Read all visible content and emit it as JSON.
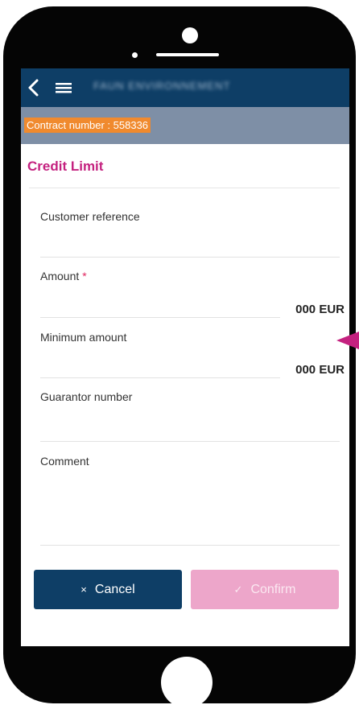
{
  "app": {
    "title": "FAUN ENVIRONNEMENT"
  },
  "contract": {
    "label": "Contract number : 558336"
  },
  "form": {
    "title": "Credit Limit",
    "customer_reference": {
      "label": "Customer reference",
      "value": ""
    },
    "amount": {
      "label": "Amount",
      "required_mark": "*",
      "value": "000 EUR"
    },
    "minimum_amount": {
      "label": "Minimum amount",
      "value": "000 EUR"
    },
    "guarantor_number": {
      "label": "Guarantor number",
      "value": ""
    },
    "comment": {
      "label": "Comment",
      "value": ""
    }
  },
  "buttons": {
    "cancel": {
      "icon": "×",
      "label": "Cancel"
    },
    "confirm": {
      "icon": "✓",
      "label": "Confirm"
    }
  },
  "icons": [
    "back-icon",
    "menu-icon",
    "close-icon",
    "check-icon",
    "pointer-arrow-icon"
  ],
  "colors": {
    "appbar": "#0e3e66",
    "contract_strip": "#7e8fa6",
    "contract_highlight": "#f08a2e",
    "title": "#c4217f",
    "cancel_button": "#0e3e66",
    "confirm_button": "#eda6ca",
    "pointer_arrow": "#c4217f"
  }
}
